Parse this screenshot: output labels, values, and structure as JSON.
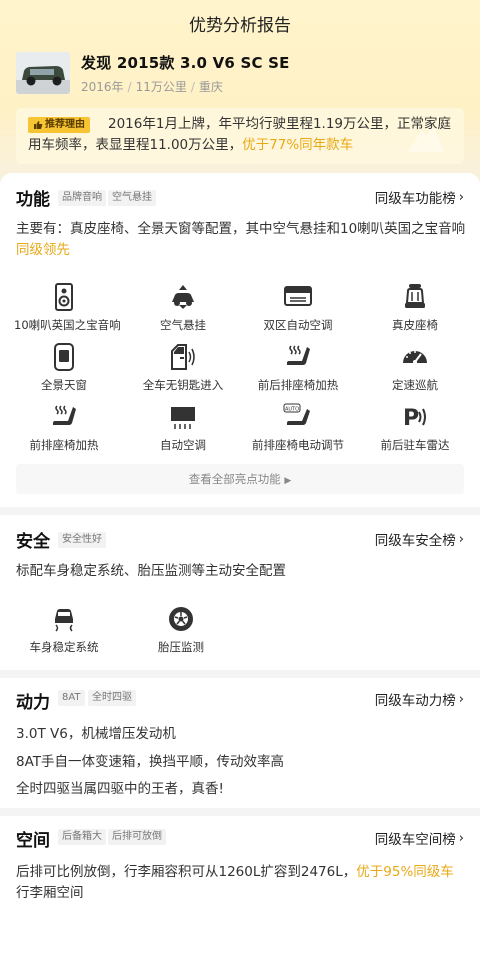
{
  "header": {
    "title": "优势分析报告"
  },
  "car": {
    "name": "发现 2015款 3.0 V6 SC SE",
    "year": "2016年",
    "mileage": "11万公里",
    "city": "重庆"
  },
  "reason": {
    "badge": "推荐理由",
    "text_main": "2016年1月上牌，年平均行驶里程1.19万公里，正常家庭用车频率，表显里程11.00万公里，",
    "text_highlight": "优于77%同年款车"
  },
  "features": {
    "title": "功能",
    "tags": [
      "品牌音响",
      "空气悬挂"
    ],
    "rank_link": "同级车功能榜",
    "desc_main": "主要有：真皮座椅、全景天窗等配置，其中空气悬挂和10喇叭英国之宝音响",
    "desc_highlight": "同级领先",
    "items": [
      {
        "label": "10喇叭英国之宝音响",
        "icon": "speaker-icon"
      },
      {
        "label": "空气悬挂",
        "icon": "air-suspension-icon"
      },
      {
        "label": "双区自动空调",
        "icon": "dual-zone-ac-icon"
      },
      {
        "label": "真皮座椅",
        "icon": "leather-seat-icon"
      },
      {
        "label": "全景天窗",
        "icon": "panoramic-sunroof-icon"
      },
      {
        "label": "全车无钥匙进入",
        "icon": "keyless-entry-icon"
      },
      {
        "label": "前后排座椅加热",
        "icon": "seat-heating-icon"
      },
      {
        "label": "定速巡航",
        "icon": "cruise-control-icon"
      },
      {
        "label": "前排座椅加热",
        "icon": "front-seat-heating-icon"
      },
      {
        "label": "自动空调",
        "icon": "auto-ac-icon"
      },
      {
        "label": "前排座椅电动调节",
        "icon": "power-seat-icon"
      },
      {
        "label": "前后驻车雷达",
        "icon": "parking-radar-icon"
      }
    ],
    "more_label": "查看全部亮点功能"
  },
  "safety": {
    "title": "安全",
    "tags": [
      "安全性好"
    ],
    "rank_link": "同级车安全榜",
    "desc": "标配车身稳定系统、胎压监测等主动安全配置",
    "items": [
      {
        "label": "车身稳定系统",
        "icon": "stability-control-icon"
      },
      {
        "label": "胎压监测",
        "icon": "tire-pressure-icon"
      }
    ]
  },
  "power": {
    "title": "动力",
    "tags": [
      "8AT",
      "全时四驱"
    ],
    "rank_link": "同级车动力榜",
    "lines": [
      "3.0T V6，机械增压发动机",
      "8AT手自一体变速箱，换挡平顺，传动效率高",
      "全时四驱当属四驱中的王者，真香!"
    ]
  },
  "space": {
    "title": "空间",
    "tags": [
      "后备箱大",
      "后排可放倒"
    ],
    "rank_link": "同级车空间榜",
    "desc_main": "后排可比例放倒，行李厢容积可从1260L扩容到2476L，",
    "desc_highlight": "优于95%同级车",
    "desc_tail": "行李厢空间"
  }
}
